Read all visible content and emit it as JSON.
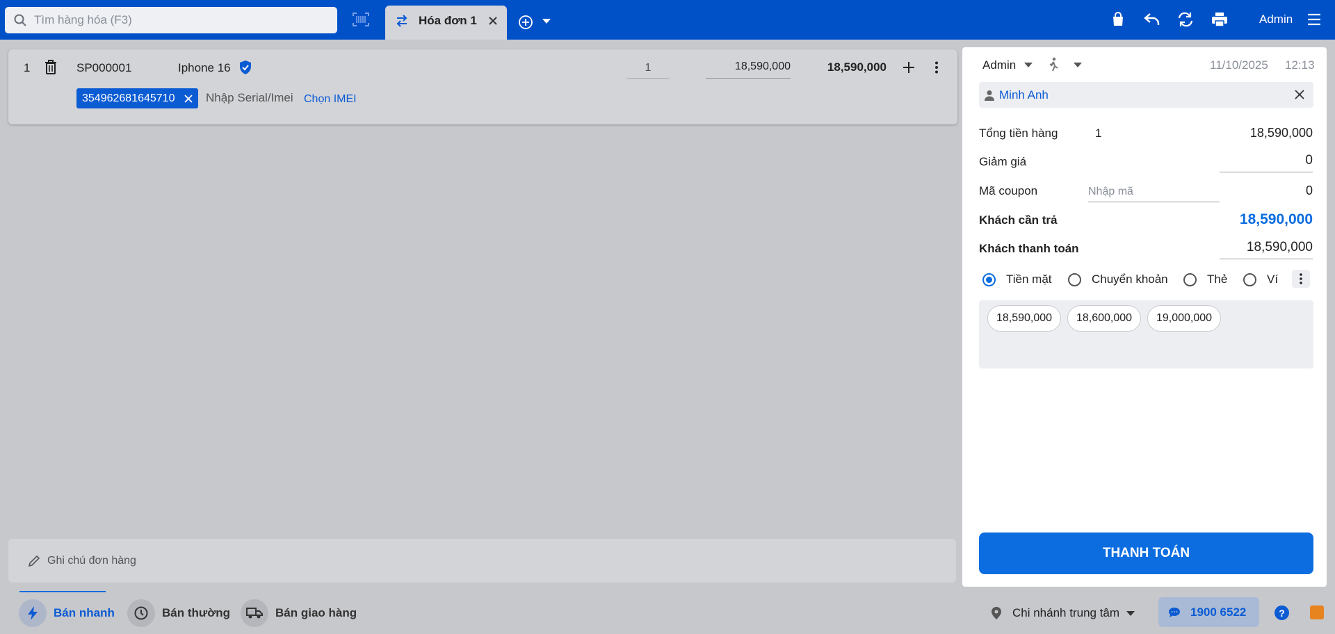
{
  "colors": {
    "brand": "#0051c7",
    "accent": "#0b6de0",
    "link": "#0b5bd3",
    "feedback": "#e8841f"
  },
  "topbar": {
    "search_placeholder": "Tìm hàng hóa (F3)",
    "tab_label": "Hóa đơn 1",
    "user_label": "Admin",
    "icons": [
      "search-icon",
      "barcode-icon",
      "swap-icon",
      "close-icon",
      "add-circle-icon",
      "caret-down-icon",
      "bag-icon",
      "undo-icon",
      "refresh-icon",
      "print-icon",
      "menu-icon"
    ]
  },
  "order_line": {
    "index": "1",
    "code": "SP000001",
    "product_name": "Iphone 16",
    "quantity": "1",
    "unit_price": "18,590,000",
    "line_total": "18,590,000",
    "imei_chip": "354962681645710",
    "serial_placeholder": "Nhập Serial/Imei",
    "choose_imei": "Chọn IMEI"
  },
  "note": {
    "placeholder": "Ghi chú đơn hàng"
  },
  "panel": {
    "seller": "Admin",
    "date": "11/10/2025",
    "time": "12:13",
    "customer_name": "Minh Anh",
    "subtotal_label": "Tổng tiền hàng",
    "subtotal_count": "1",
    "subtotal_value": "18,590,000",
    "discount_label": "Giảm giá",
    "discount_value": "0",
    "coupon_label": "Mã coupon",
    "coupon_placeholder": "Nhập mã",
    "coupon_value": "0",
    "due_label": "Khách cần trả",
    "due_value": "18,590,000",
    "paid_label": "Khách thanh toán",
    "paid_value": "18,590,000",
    "methods": [
      {
        "label": "Tiền mặt",
        "selected": true
      },
      {
        "label": "Chuyển khoản",
        "selected": false
      },
      {
        "label": "Thẻ",
        "selected": false
      },
      {
        "label": "Ví",
        "selected": false
      }
    ],
    "quick_amounts": [
      "18,590,000",
      "18,600,000",
      "19,000,000"
    ],
    "pay_button": "THANH TOÁN"
  },
  "bottombar": {
    "modes": [
      "Bán nhanh",
      "Bán thường",
      "Bán giao hàng"
    ],
    "active_mode": "Bán nhanh",
    "branch": "Chi nhánh trung tâm",
    "hotline": "1900 6522",
    "help": "?"
  }
}
